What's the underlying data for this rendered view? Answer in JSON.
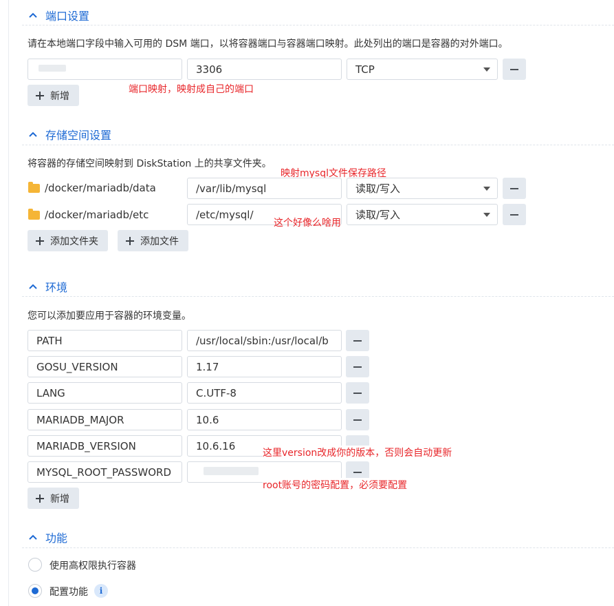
{
  "port": {
    "title": "端口设置",
    "description": "请在本地端口字段中输入可用的 DSM 端口，以将容器端口与容器端口映射。此处列出的端口是容器的对外端口。",
    "rows": [
      {
        "local": "",
        "container": "3306",
        "protocol": "TCP"
      }
    ],
    "add_label": "新增",
    "note": "端口映射，映射成自己的端口"
  },
  "storage": {
    "title": "存储空间设置",
    "description": "将容器的存储空间映射到 DiskStation 上的共享文件夹。",
    "rows": [
      {
        "folder": "/docker/mariadb/data",
        "mount": "/var/lib/mysql",
        "mode": "读取/写入"
      },
      {
        "folder": "/docker/mariadb/etc",
        "mount": "/etc/mysql/",
        "mode": "读取/写入"
      }
    ],
    "add_folder_label": "添加文件夹",
    "add_file_label": "添加文件",
    "note_mysql": "映射mysql文件保存路径",
    "note_etc": "这个好像么啥用"
  },
  "env": {
    "title": "环境",
    "description": "您可以添加要应用于容器的环境变量。",
    "rows": [
      {
        "key": "PATH",
        "value": "/usr/local/sbin:/usr/local/b"
      },
      {
        "key": "GOSU_VERSION",
        "value": "1.17"
      },
      {
        "key": "LANG",
        "value": "C.UTF-8"
      },
      {
        "key": "MARIADB_MAJOR",
        "value": "10.6"
      },
      {
        "key": "MARIADB_VERSION",
        "value": "10.6.16"
      },
      {
        "key": "MYSQL_ROOT_PASSWORD",
        "value": " "
      }
    ],
    "add_label": "新增",
    "note_version": "这里version改成你的版本，否则会自动更新",
    "note_password": "root账号的密码配置，必须要配置"
  },
  "features": {
    "title": "功能",
    "options": [
      {
        "label": "使用高权限执行容器",
        "checked": false
      },
      {
        "label": "配置功能",
        "checked": true
      }
    ],
    "info_glyph": "i"
  },
  "colors": {
    "accent": "#1e6ad4",
    "annotation": "#e8262a",
    "button_bg": "#e4e9ef"
  }
}
